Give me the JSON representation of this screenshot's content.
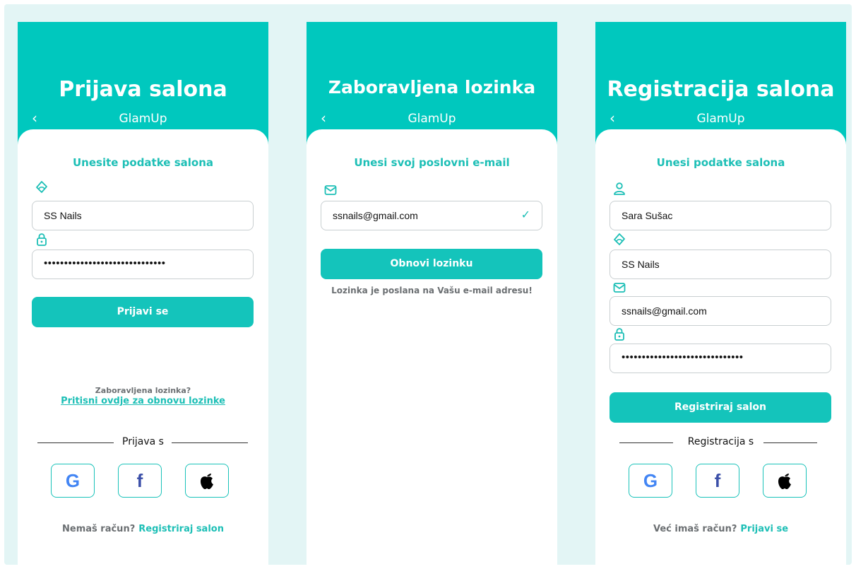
{
  "colors": {
    "accent": "#00c8be",
    "background": "#e3f5f5",
    "text": "#111111",
    "muted": "#6b6f72"
  },
  "brand": "GlamUp",
  "login": {
    "title": "Prijava salona",
    "subtitle": "Unesite podatke salona",
    "salon_value": "SS Nails",
    "password_value": "••••••••••••••••••••••••••••••",
    "submit_label": "Prijavi se",
    "forgot_text": "Zaboravljena lozinka?",
    "forgot_link": "Pritisni ovdje za obnovu lozinke",
    "divider": "Prijava s",
    "footer_text": "Nemaš račun?",
    "footer_link": "Registriraj salon"
  },
  "forgot": {
    "title": "Zaboravljena lozinka",
    "subtitle": "Unesi svoj poslovni e-mail",
    "email_value": "ssnails@gmail.com",
    "valid_mark": "✓",
    "submit_label": "Obnovi lozinku",
    "confirmation": "Lozinka je poslana na Vašu e-mail adresu!"
  },
  "register": {
    "title": "Registracija salona",
    "subtitle": "Unesi podatke salona",
    "name_value": "Sara Sušac",
    "salon_value": "SS Nails",
    "email_value": "ssnails@gmail.com",
    "password_value": "••••••••••••••••••••••••••••••",
    "submit_label": "Registriraj salon",
    "divider": "Registracija s",
    "footer_text": "Već imaš račun?",
    "footer_link": "Prijavi se"
  },
  "icons": {
    "back": "‹",
    "salon": "nail-polish-icon",
    "lock": "lock-icon",
    "mail": "mail-icon",
    "user": "user-icon",
    "google": "google-icon",
    "facebook": "facebook-icon",
    "apple": "apple-icon"
  },
  "social_glyphs": {
    "google": "G",
    "facebook": "f"
  }
}
